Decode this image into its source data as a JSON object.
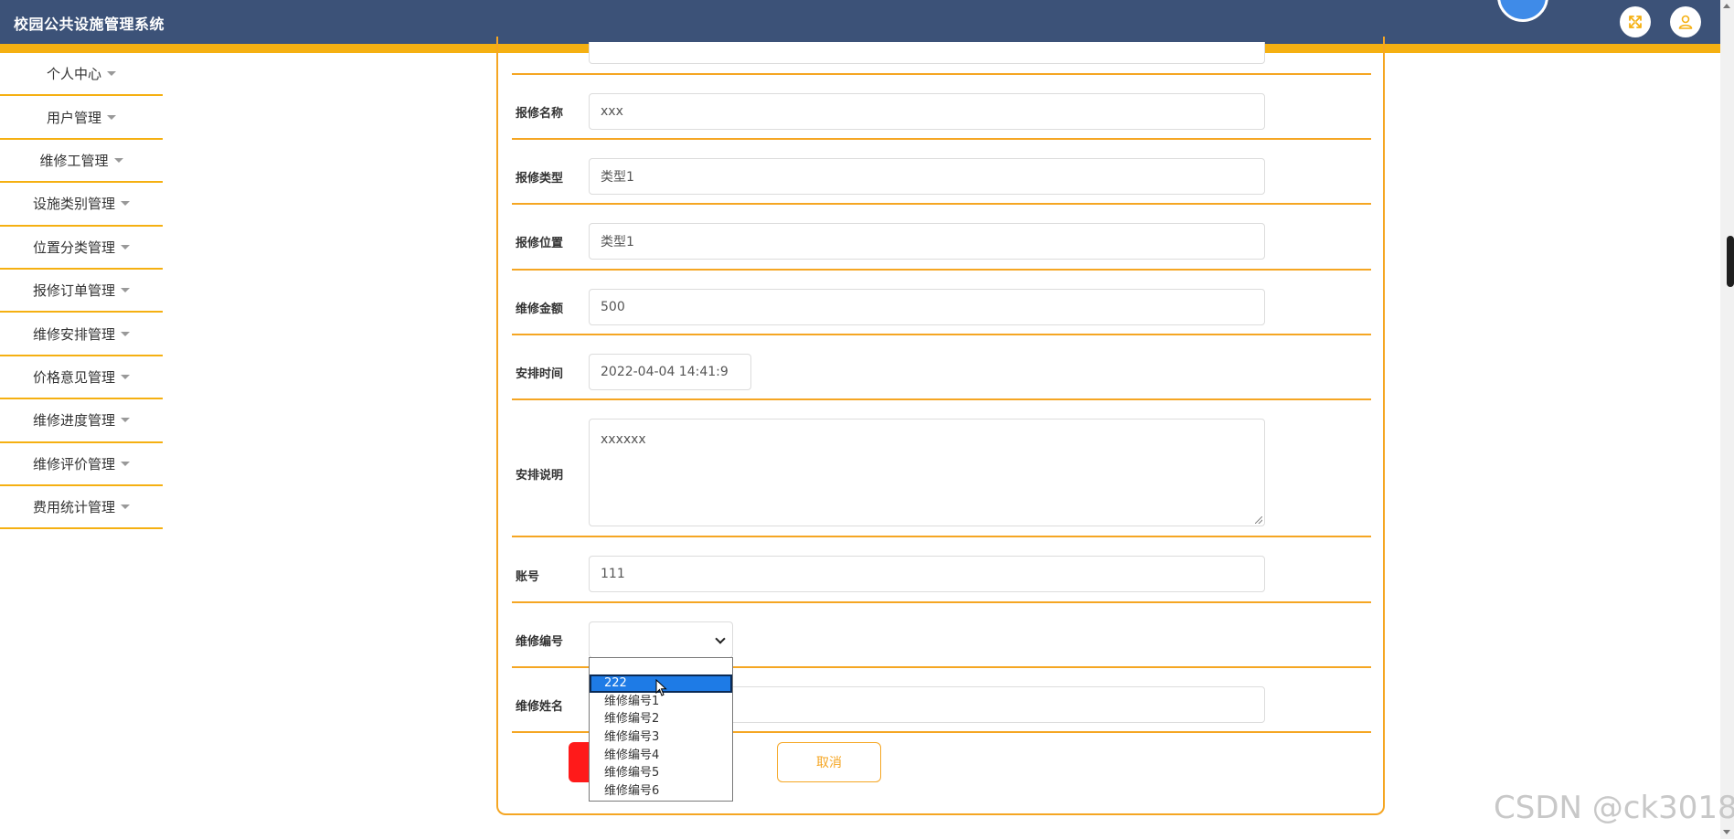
{
  "header": {
    "title": "校园公共设施管理系统",
    "fullscreen_icon": "expand-icon",
    "user_icon": "user-icon",
    "brand_color": "#3c5278",
    "accent_color": "#f5b012"
  },
  "sidebar": {
    "items": [
      {
        "label": "个人中心"
      },
      {
        "label": "用户管理"
      },
      {
        "label": "维修工管理"
      },
      {
        "label": "设施类别管理"
      },
      {
        "label": "位置分类管理"
      },
      {
        "label": "报修订单管理"
      },
      {
        "label": "维修安排管理"
      },
      {
        "label": "价格意见管理"
      },
      {
        "label": "维修进度管理"
      },
      {
        "label": "维修评价管理"
      },
      {
        "label": "费用统计管理"
      }
    ]
  },
  "form": {
    "repair_name": {
      "label": "报修名称",
      "value": "xxx"
    },
    "repair_type": {
      "label": "报修类型",
      "value": "类型1"
    },
    "repair_location": {
      "label": "报修位置",
      "value": "类型1"
    },
    "amount": {
      "label": "维修金额",
      "value": "500"
    },
    "schedule_time": {
      "label": "安排时间",
      "value": "2022-04-04 14:41:9"
    },
    "description": {
      "label": "安排说明",
      "value": "xxxxxx"
    },
    "account": {
      "label": "账号",
      "value": "111"
    },
    "worker_id": {
      "label": "维修编号",
      "value": "",
      "options": [
        "222",
        "维修编号1",
        "维修编号2",
        "维修编号3",
        "维修编号4",
        "维修编号5",
        "维修编号6"
      ],
      "highlighted": "222"
    },
    "worker_name": {
      "label": "维修姓名",
      "value": ""
    },
    "cancel_label": "取消"
  },
  "watermark": "CSDN @ck3018"
}
